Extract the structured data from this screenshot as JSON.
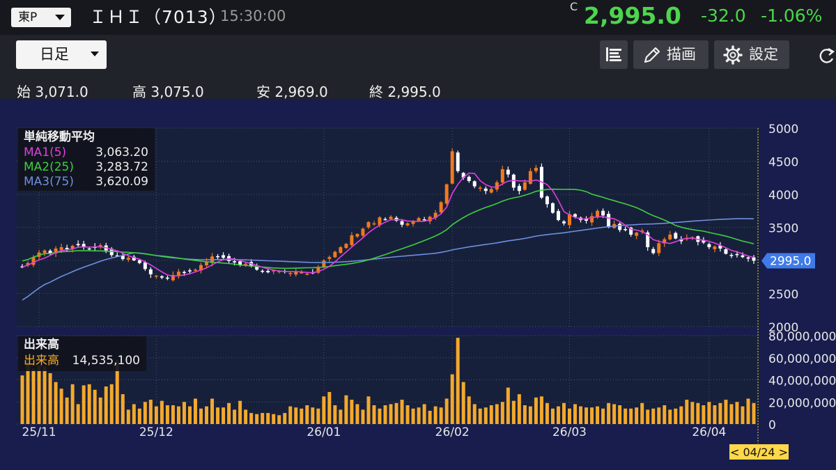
{
  "header": {
    "exchange": "東P",
    "stock_name": "ＩＨＩ（7013）",
    "time": "15:30:00",
    "c_mark": "C",
    "last_price": "2,995.0",
    "change": "-32.0",
    "change_pct": "-1.06%"
  },
  "toolbar": {
    "period": "日足",
    "draw_label": "描画",
    "settings_label": "設定"
  },
  "ohlc": {
    "open_label": "始",
    "open": "3,071.0",
    "high_label": "高",
    "high": "3,075.0",
    "low_label": "安",
    "low": "2,969.0",
    "close_label": "終",
    "close": "2,995.0"
  },
  "colors": {
    "up": "#f07a1e",
    "down": "#ffffff",
    "ma1": "#e040e0",
    "ma2": "#3ecf3e",
    "ma3": "#6f8fe0",
    "volume": "#f4a92c",
    "price_tag": "#3f7be8",
    "price_green": "#4cd64c"
  },
  "chart_data": {
    "type": "candlestick",
    "price_axis": {
      "ticks": [
        "5000",
        "4500",
        "4000",
        "3500",
        "3000",
        "2500",
        "2000"
      ],
      "ylim": [
        2000,
        5000
      ]
    },
    "volume_axis": {
      "ticks": [
        "80,000,000",
        "60,000,000",
        "40,000,000",
        "20,000,000",
        "0"
      ],
      "ylim": [
        0,
        80000000
      ]
    },
    "x_labels": [
      "25/11",
      "25/12",
      "26/01",
      "26/02",
      "26/03",
      "26/04"
    ],
    "current_price_label": "2995.0",
    "date_marker": "< 04/24 >",
    "ma_legend": {
      "title": "単純移動平均",
      "items": [
        {
          "name": "MA1(5)",
          "value": "3,063.20"
        },
        {
          "name": "MA2(25)",
          "value": "3,283.72"
        },
        {
          "name": "MA3(75)",
          "value": "3,620.09"
        }
      ]
    },
    "volume_legend": {
      "title": "出来高",
      "name": "出来高",
      "value": "14,535,100"
    },
    "close_series": [
      2900,
      2960,
      3050,
      3120,
      3150,
      3100,
      3180,
      3200,
      3170,
      3220,
      3230,
      3200,
      3180,
      3190,
      3230,
      3150,
      3080,
      3070,
      3020,
      3040,
      3000,
      2960,
      2870,
      2790,
      2770,
      2740,
      2730,
      2780,
      2830,
      2820,
      2840,
      2860,
      2930,
      2980,
      3060,
      3050,
      3040,
      2990,
      2970,
      2930,
      2950,
      2910,
      2860,
      2830,
      2820,
      2850,
      2840,
      2830,
      2810,
      2830,
      2820,
      2800,
      2810,
      2900,
      3000,
      3050,
      3130,
      3200,
      3250,
      3380,
      3400,
      3480,
      3580,
      3560,
      3650,
      3620,
      3660,
      3600,
      3540,
      3560,
      3600,
      3640,
      3620,
      3660,
      3720,
      3880,
      4150,
      4650,
      4350,
      4250,
      4200,
      4120,
      4100,
      4050,
      4080,
      4180,
      4380,
      4300,
      4100,
      4050,
      4180,
      4350,
      4400,
      3950,
      3850,
      3720,
      3610,
      3560,
      3700,
      3660,
      3610,
      3600,
      3670,
      3750,
      3680,
      3500,
      3550,
      3460,
      3470,
      3390,
      3420,
      3450,
      3200,
      3110,
      3260,
      3320,
      3390,
      3330,
      3290,
      3340,
      3350,
      3280,
      3270,
      3200,
      3210,
      3180,
      3100,
      3070,
      3090,
      3050,
      3027,
      2995
    ],
    "volume_series": [
      44,
      62,
      50,
      53,
      52,
      46,
      38,
      32,
      24,
      36,
      18,
      35,
      36,
      31,
      24,
      34,
      36,
      58,
      27,
      13,
      18,
      14,
      20,
      22,
      16,
      21,
      17,
      17,
      16,
      20,
      16,
      23,
      14,
      16,
      23,
      15,
      15,
      19,
      13,
      21,
      13,
      10,
      9,
      10,
      10,
      9,
      8,
      10,
      16,
      15,
      14,
      17,
      15,
      14,
      25,
      29,
      17,
      13,
      26,
      22,
      18,
      13,
      25,
      17,
      14,
      17,
      18,
      19,
      22,
      17,
      14,
      15,
      18,
      12,
      16,
      15,
      23,
      45,
      78,
      38,
      25,
      18,
      14,
      15,
      17,
      18,
      20,
      33,
      21,
      27,
      17,
      16,
      24,
      25,
      19,
      14,
      16,
      19,
      14,
      18,
      16,
      15,
      15,
      16,
      14,
      19,
      18,
      17,
      14,
      14,
      15,
      19,
      13,
      14,
      15,
      17,
      13,
      14,
      16,
      22,
      20,
      19,
      17,
      20,
      17,
      19,
      22,
      18,
      20,
      16,
      23,
      19
    ]
  }
}
